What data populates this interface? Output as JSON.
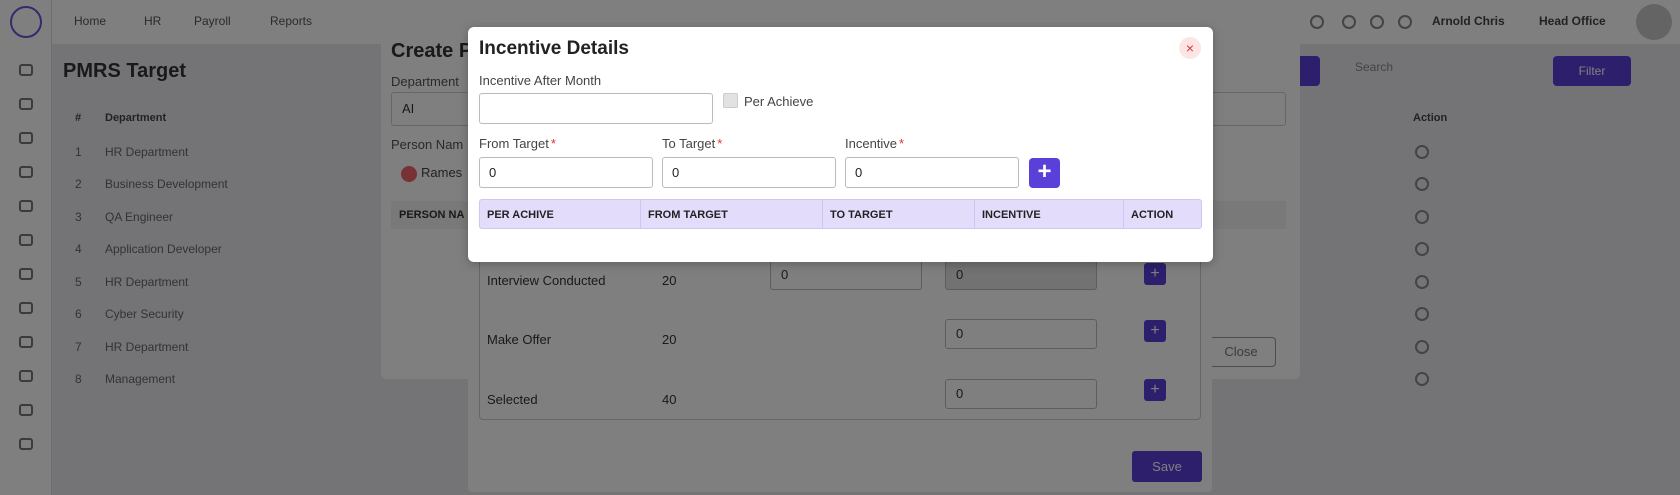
{
  "background": {
    "nav": [
      "Home",
      "HR",
      "Payroll",
      "Reports"
    ],
    "user_name": "Arnold Chris",
    "office": "Head Office",
    "page_title": "PMRS Target",
    "table_header": "Department",
    "action_header": "Action",
    "search_placeholder": "Search",
    "filter_label": "Filter",
    "rows": [
      {
        "n": "1",
        "name": "HR Department"
      },
      {
        "n": "2",
        "name": "Business Development"
      },
      {
        "n": "3",
        "name": "QA Engineer"
      },
      {
        "n": "4",
        "name": "Application Developer"
      },
      {
        "n": "5",
        "name": "HR Department"
      },
      {
        "n": "6",
        "name": "Cyber Security"
      },
      {
        "n": "7",
        "name": "HR Department"
      },
      {
        "n": "8",
        "name": "Management"
      }
    ],
    "create_panel": {
      "title": "Create P",
      "department_label": "Department",
      "department_value": "AI",
      "person_label": "Person Nam",
      "person_chip": "Rames",
      "person_col": "PERSON NA",
      "close_label": "Close"
    },
    "modal2": {
      "rows": [
        {
          "label": "Interview Conducted",
          "count": "20",
          "to_target": "0",
          "incentive": "0"
        },
        {
          "label": "Make Offer",
          "count": "20",
          "incentive": "0"
        },
        {
          "label": "Selected",
          "count": "40",
          "incentive": "0"
        }
      ],
      "plus": "+",
      "save_label": "Save"
    }
  },
  "modal": {
    "title": "Incentive Details",
    "close_glyph": "×",
    "incentive_after_month_label": "Incentive After Month",
    "incentive_after_month_value": "",
    "per_achieve_label": "Per Achieve",
    "from_target_label": "From Target",
    "from_target_value": "0",
    "to_target_label": "To Target",
    "to_target_value": "0",
    "incentive_label": "Incentive",
    "incentive_value": "0",
    "required_mark": "*",
    "add_glyph": "+",
    "table_columns": [
      "PER ACHIVE",
      "FROM TARGET",
      "TO TARGET",
      "INCENTIVE",
      "ACTION"
    ]
  },
  "colors": {
    "accent": "#5a3fd9",
    "table_header_bg": "#e4dcfb",
    "close_red": "#d33333"
  }
}
